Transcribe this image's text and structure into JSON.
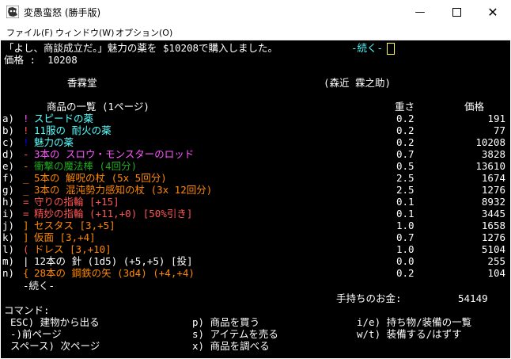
{
  "window": {
    "title": "変愚蛮怒 (勝手版)"
  },
  "menu": [
    "ファイル(F)",
    "ウィンドウ(W)",
    "オプション(O)"
  ],
  "message": {
    "text": "「よし、商談成立だ。」魅力の薬を $10208で購入しました。",
    "more": "-続く-"
  },
  "price_line": "価格 :  10208",
  "store": {
    "name": "香霖堂",
    "owner": "(森近 霖之助)"
  },
  "list_header": {
    "title": "商品の一覧 (1ページ)",
    "weight": "重さ",
    "price": "価格"
  },
  "items": [
    {
      "key": "a)",
      "sym": "!",
      "name": "スピードの薬",
      "weight": "0.2",
      "price": "191",
      "sym_color": "#ff55ff",
      "color": "#55ffff"
    },
    {
      "key": "b)",
      "sym": "!",
      "name": "11服の 耐火の薬",
      "weight": "0.2",
      "price": "77",
      "sym_color": "#ff5555",
      "color": "#55ffff"
    },
    {
      "key": "c)",
      "sym": "!",
      "name": "魅力の薬",
      "weight": "0.2",
      "price": "10208",
      "sym_color": "#0000ff",
      "color": "#55ffff"
    },
    {
      "key": "d)",
      "sym": "-",
      "name": "3本の スロウ・モンスターのロッド",
      "weight": "0.7",
      "price": "3828",
      "sym_color": "#ff5555",
      "color": "#ff55ff"
    },
    {
      "key": "e)",
      "sym": "-",
      "name": "衝撃の魔法棒 (4回分)",
      "weight": "0.5",
      "price": "13610",
      "sym_color": "#ff8800",
      "color": "#22aa22"
    },
    {
      "key": "f)",
      "sym": "_",
      "name": "5本の 解呪の杖 (5x 5回分)",
      "weight": "2.5",
      "price": "1674",
      "sym_color": "#ff8800",
      "color": "#ff8800"
    },
    {
      "key": "g)",
      "sym": "_",
      "name": "3本の 混沌勢力感知の杖 (3x 12回分)",
      "weight": "2.5",
      "price": "1276",
      "sym_color": "#ff8800",
      "color": "#ff8800"
    },
    {
      "key": "h)",
      "sym": "=",
      "name": "守りの指輪 [+15]",
      "weight": "0.1",
      "price": "8932",
      "sym_color": "#ff5555",
      "color": "#ff5555"
    },
    {
      "key": "i)",
      "sym": "=",
      "name": "精妙の指輪 (+11,+0) [50%引き]",
      "weight": "0.1",
      "price": "3445",
      "sym_color": "#ff5555",
      "color": "#ff5555"
    },
    {
      "key": "j)",
      "sym": "]",
      "name": "セスタス [3,+5]",
      "weight": "1.0",
      "price": "1658",
      "sym_color": "#ff8800",
      "color": "#ff8800"
    },
    {
      "key": "k)",
      "sym": "]",
      "name": "仮面 [3,+4]",
      "weight": "0.7",
      "price": "1276",
      "sym_color": "#ff8800",
      "color": "#ff8800"
    },
    {
      "key": "l)",
      "sym": "(",
      "name": "ドレス [3,+10]",
      "weight": "1.0",
      "price": "5104",
      "sym_color": "#ff5555",
      "color": "#ff8800"
    },
    {
      "key": "m)",
      "sym": "|",
      "name": "12本の 針 (1d5) (+5,+5) [投]",
      "weight": "0.0",
      "price": "255",
      "sym_color": "#ffffff",
      "color": "#ffffff"
    },
    {
      "key": "n)",
      "sym": "{",
      "name": "28本の 鋼鉄の矢 (3d4) (+4,+4)",
      "weight": "0.2",
      "price": "104",
      "sym_color": "#ff8800",
      "color": "#ff8800"
    }
  ],
  "more_line": "-続く-",
  "gold": {
    "label": "手持ちのお金:",
    "value": "54149"
  },
  "commands": {
    "title": "コマンド:",
    "col1": [
      "ESC) 建物から出る",
      "-)前ページ",
      "スペース) 次ページ"
    ],
    "col2": [
      "p) 商品を買う",
      "s) アイテムを売る",
      "x) 商品を調べる"
    ],
    "col3": [
      "i/e) 持ち物/装備の一覧",
      "w/t) 装備する/はずす"
    ]
  },
  "colors": {
    "more": "#55ffff",
    "cursor": "#ffff55"
  }
}
